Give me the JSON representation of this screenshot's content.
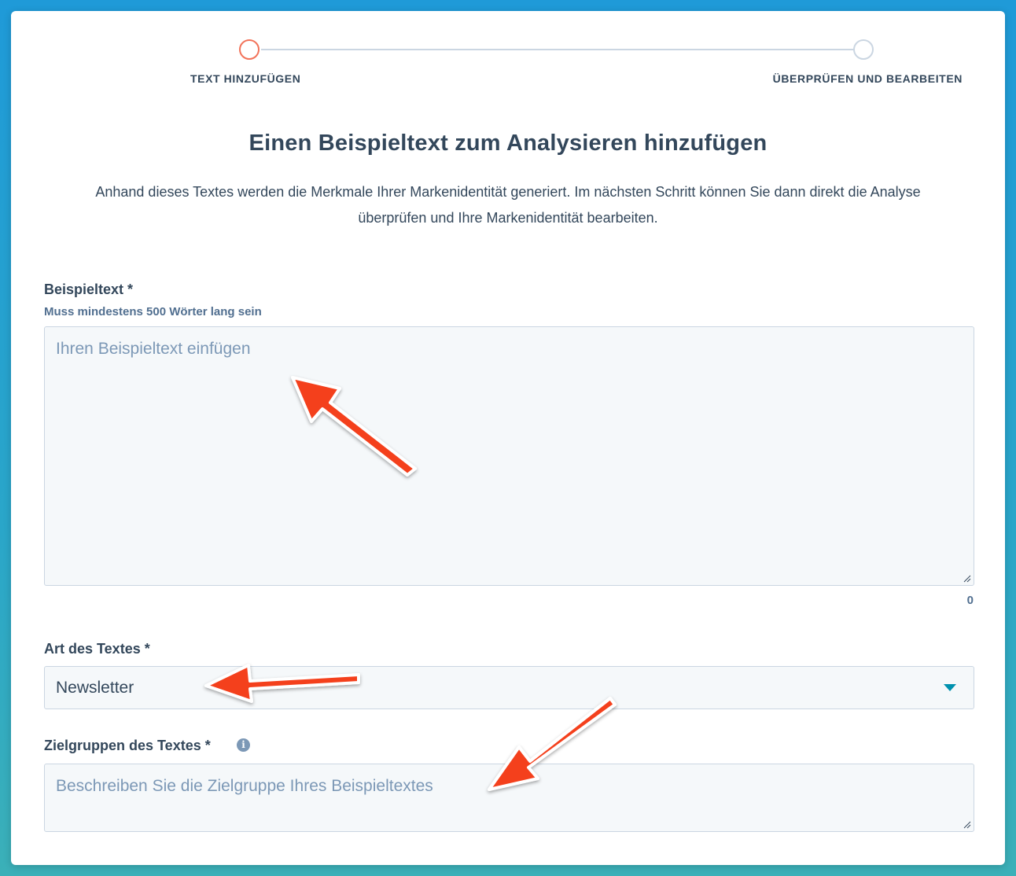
{
  "stepper": {
    "step1_label": "TEXT HINZUFÜGEN",
    "step2_label": "ÜBERPRÜFEN UND BEARBEITEN"
  },
  "heading": "Einen Beispieltext zum Analysieren hinzufügen",
  "subtext": "Anhand dieses Textes werden die Merkmale Ihrer Markenidentität generiert. Im nächsten Schritt können Sie dann direkt die Analyse überprüfen und Ihre Markenidentität bearbeiten.",
  "sample_text": {
    "label": "Beispieltext *",
    "hint": "Muss mindestens 500 Wörter lang sein",
    "placeholder": "Ihren Beispieltext einfügen",
    "word_count": "0"
  },
  "text_type": {
    "label": "Art des Textes *",
    "selected": "Newsletter"
  },
  "audience": {
    "label": "Zielgruppen des Textes *",
    "placeholder": "Beschreiben Sie die Zielgruppe Ihres Beispieltextes"
  },
  "colors": {
    "accent_active": "#f2735a",
    "annotation_arrow": "#f4401e",
    "caret": "#0091ae"
  }
}
